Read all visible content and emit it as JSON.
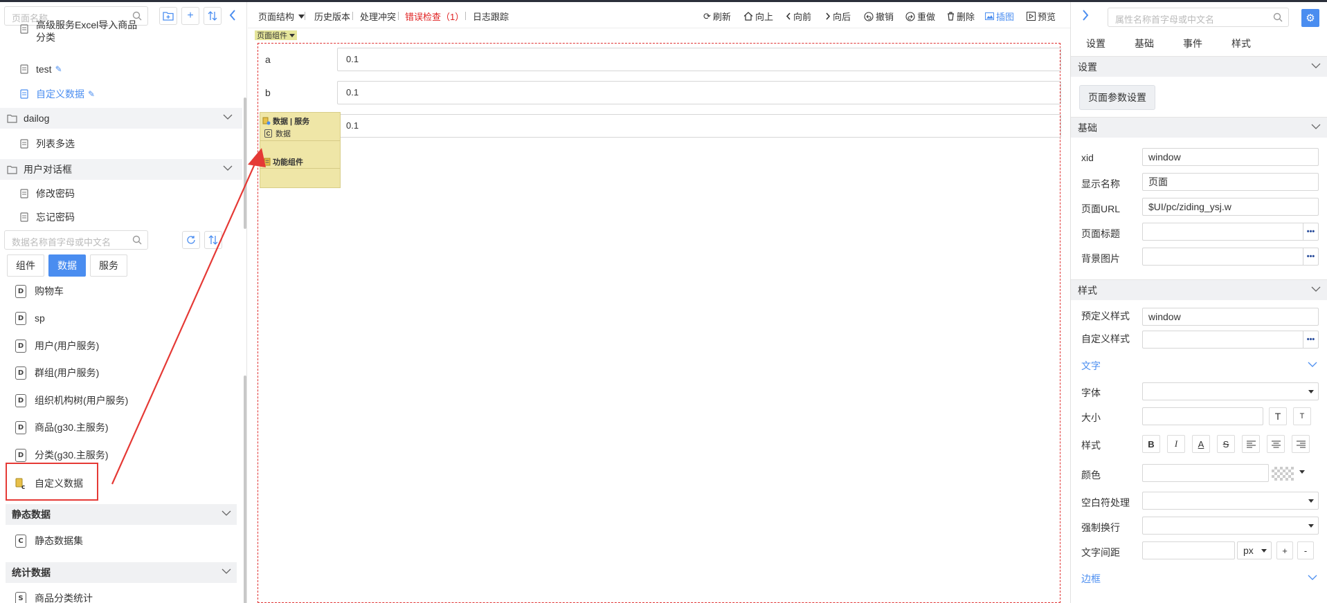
{
  "left": {
    "page_search_placeholder": "页面名称",
    "tree": {
      "item_partial": "高级服务Excel导入商品",
      "item_partial_line2": "分类",
      "item_test": "test",
      "item_custom": "自定义数据",
      "folder_dailog": "dailog",
      "item_list_multi": "列表多选",
      "folder_user_dialog": "用户对话框",
      "item_change_pwd": "修改密码",
      "item_forget_pwd": "忘记密码"
    },
    "data_search_placeholder": "数据名称首字母或中文名",
    "tabs": [
      "组件",
      "数据",
      "服务"
    ],
    "data_items": [
      "购物车",
      "sp",
      "用户(用户服务)",
      "群组(用户服务)",
      "组织机构树(用户服务)",
      "商品(g30.主服务)",
      "分类(g30.主服务)"
    ],
    "data_icon_letter": "D",
    "selected_item": "自定义数据",
    "sections": {
      "static_data": "静态数据",
      "static_item": "静态数据集",
      "static_icon_letter": "C",
      "stats_data": "统计数据",
      "stats_item": "商品分类统计",
      "stats_icon_letter": "S"
    }
  },
  "toolbar": {
    "page_structure": "页面结构",
    "history": "历史版本",
    "conflict": "处理冲突",
    "error_check": "错误检查（1）",
    "log": "日志跟踪",
    "refresh": "刷新",
    "up": "向上",
    "forward": "向前",
    "backward": "向后",
    "undo": "撤销",
    "redo": "重做",
    "delete": "删除",
    "insert_image": "插图",
    "preview": "预览"
  },
  "canvas": {
    "page_component_tag": "页面组件",
    "rows": [
      {
        "label": "a",
        "value": "0.1"
      },
      {
        "label": "b",
        "value": "0.1"
      },
      {
        "label": "",
        "value": "0.1"
      }
    ],
    "popup": {
      "header": "数据 | 服务",
      "data_item": "数据",
      "data_item_letter": "C",
      "func": "功能组件"
    }
  },
  "right": {
    "search_placeholder": "属性名称首字母或中文名",
    "tabs": [
      "设置",
      "基础",
      "事件",
      "样式"
    ],
    "settings": {
      "title": "设置",
      "page_param_button": "页面参数设置"
    },
    "basic": {
      "title": "基础",
      "fields": [
        {
          "label": "xid",
          "value": "window"
        },
        {
          "label": "显示名称",
          "value": "页面"
        },
        {
          "label": "页面URL",
          "value": "$UI/pc/ziding_ysj.w"
        },
        {
          "label": "页面标题",
          "value": ""
        },
        {
          "label": "背景图片",
          "value": ""
        }
      ]
    },
    "style": {
      "title": "样式",
      "predef_label": "预定义样式",
      "predef_value": "window",
      "custom_label": "自定义样式",
      "text_sub": "文字",
      "font_label": "字体",
      "size_label": "大小",
      "style_label": "样式",
      "color_label": "颜色",
      "whitespace_label": "空白符处理",
      "wrap_label": "强制换行",
      "spacing_label": "文字间距",
      "spacing_unit": "px",
      "plus": "+",
      "minus": "-",
      "border_sub": "边框",
      "style_buttons": [
        "B",
        "I",
        "A",
        "S"
      ]
    },
    "dots": "•••"
  },
  "colors": {
    "accent": "#4a8df0",
    "error": "#e02020",
    "arrow": "#e53935",
    "popup_bg": "#efe6a7"
  }
}
